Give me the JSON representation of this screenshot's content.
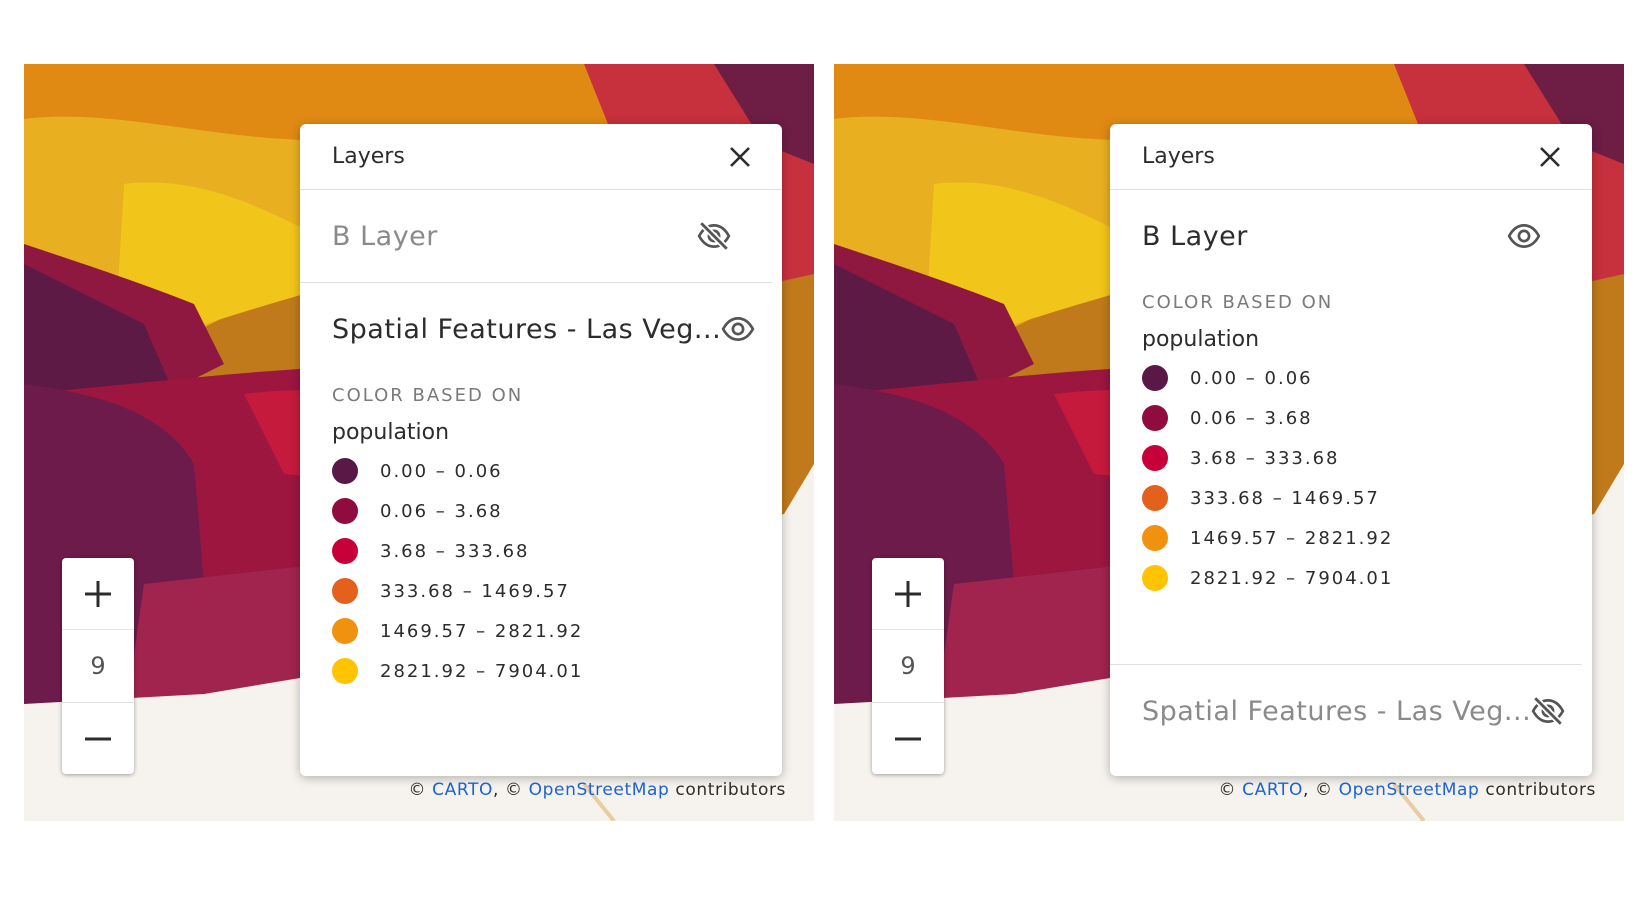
{
  "palette": {
    "c1": "#5a1846",
    "c2": "#900c3f",
    "c3": "#c70039",
    "c4": "#e3611c",
    "c5": "#f1920e",
    "c6": "#ffc300"
  },
  "attribution": {
    "copyright_symbol_1": "©",
    "carto": "CARTO",
    "separator": ", ",
    "copyright_symbol_2": "©",
    "osm": "OpenStreetMap",
    "contributors": " contributors"
  },
  "left": {
    "zoom": {
      "plus_icon": "plus-icon",
      "level": "9",
      "minus_icon": "minus-icon"
    },
    "panel": {
      "title": "Layers",
      "close_icon": "close-icon",
      "layer_b": {
        "name": "B Layer",
        "visible": false
      },
      "layer_spatial": {
        "name": "Spatial Features - Las Veg...",
        "visible": true,
        "legend": {
          "heading": "COLOR BASED ON",
          "field": "population",
          "items": [
            {
              "label": "0.00 – 0.06",
              "color": "#5a1846"
            },
            {
              "label": "0.06 – 3.68",
              "color": "#900c3f"
            },
            {
              "label": "3.68 – 333.68",
              "color": "#c70039"
            },
            {
              "label": "333.68 – 1469.57",
              "color": "#e3611c"
            },
            {
              "label": "1469.57 – 2821.92",
              "color": "#f1920e"
            },
            {
              "label": "2821.92 – 7904.01",
              "color": "#ffc300"
            }
          ]
        }
      }
    }
  },
  "right": {
    "zoom": {
      "plus_icon": "plus-icon",
      "level": "9",
      "minus_icon": "minus-icon"
    },
    "panel": {
      "title": "Layers",
      "close_icon": "close-icon",
      "layer_b": {
        "name": "B Layer",
        "visible": true,
        "legend": {
          "heading": "COLOR BASED ON",
          "field": "population",
          "items": [
            {
              "label": "0.00 – 0.06",
              "color": "#5a1846"
            },
            {
              "label": "0.06 – 3.68",
              "color": "#900c3f"
            },
            {
              "label": "3.68 – 333.68",
              "color": "#c70039"
            },
            {
              "label": "333.68 – 1469.57",
              "color": "#e3611c"
            },
            {
              "label": "1469.57 – 2821.92",
              "color": "#f1920e"
            },
            {
              "label": "2821.92 – 7904.01",
              "color": "#ffc300"
            }
          ]
        }
      },
      "layer_spatial": {
        "name": "Spatial Features - Las Veg...",
        "visible": false
      }
    }
  }
}
